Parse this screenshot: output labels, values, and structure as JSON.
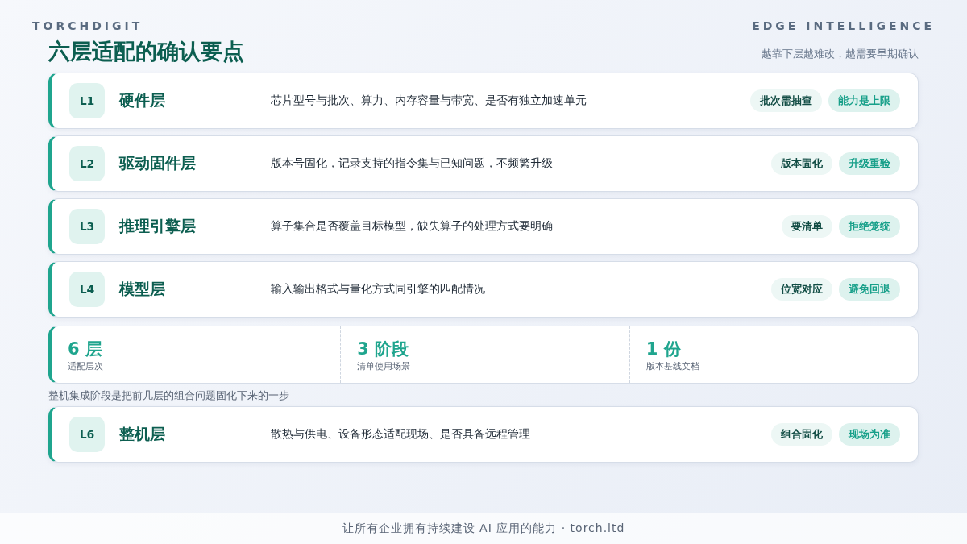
{
  "brand": "TORCHDIGIT",
  "tagline": "EDGE INTELLIGENCE",
  "title": "六层适配的确认要点",
  "subtitle": "越靠下层越难改，越需要早期确认",
  "layers": [
    {
      "code": "L1",
      "name": "硬件层",
      "desc": "芯片型号与批次、算力、内存容量与带宽、是否有独立加速单元",
      "tags": [
        "批次需抽查",
        "能力是上限"
      ]
    },
    {
      "code": "L2",
      "name": "驱动固件层",
      "desc": "版本号固化，记录支持的指令集与已知问题，不频繁升级",
      "tags": [
        "版本固化",
        "升级重验"
      ]
    },
    {
      "code": "L3",
      "name": "推理引擎层",
      "desc": "算子集合是否覆盖目标模型，缺失算子的处理方式要明确",
      "tags": [
        "要清单",
        "拒绝笼统"
      ]
    },
    {
      "code": "L4",
      "name": "模型层",
      "desc": "输入输出格式与量化方式同引擎的匹配情况",
      "tags": [
        "位宽对应",
        "避免回退"
      ]
    }
  ],
  "stats": [
    {
      "value": "6 层",
      "label": "适配层次"
    },
    {
      "value": "3 阶段",
      "label": "清单使用场景"
    },
    {
      "value": "1 份",
      "label": "版本基线文档"
    }
  ],
  "note": "整机集成阶段是把前几层的组合问题固化下来的一步",
  "last_layer": {
    "code": "L6",
    "name": "整机层",
    "desc": "散热与供电、设备形态适配现场、是否具备远程管理",
    "tags": [
      "组合固化",
      "现场为准"
    ]
  },
  "footer": "让所有企业拥有持续建设 AI 应用的能力 · torch.ltd"
}
